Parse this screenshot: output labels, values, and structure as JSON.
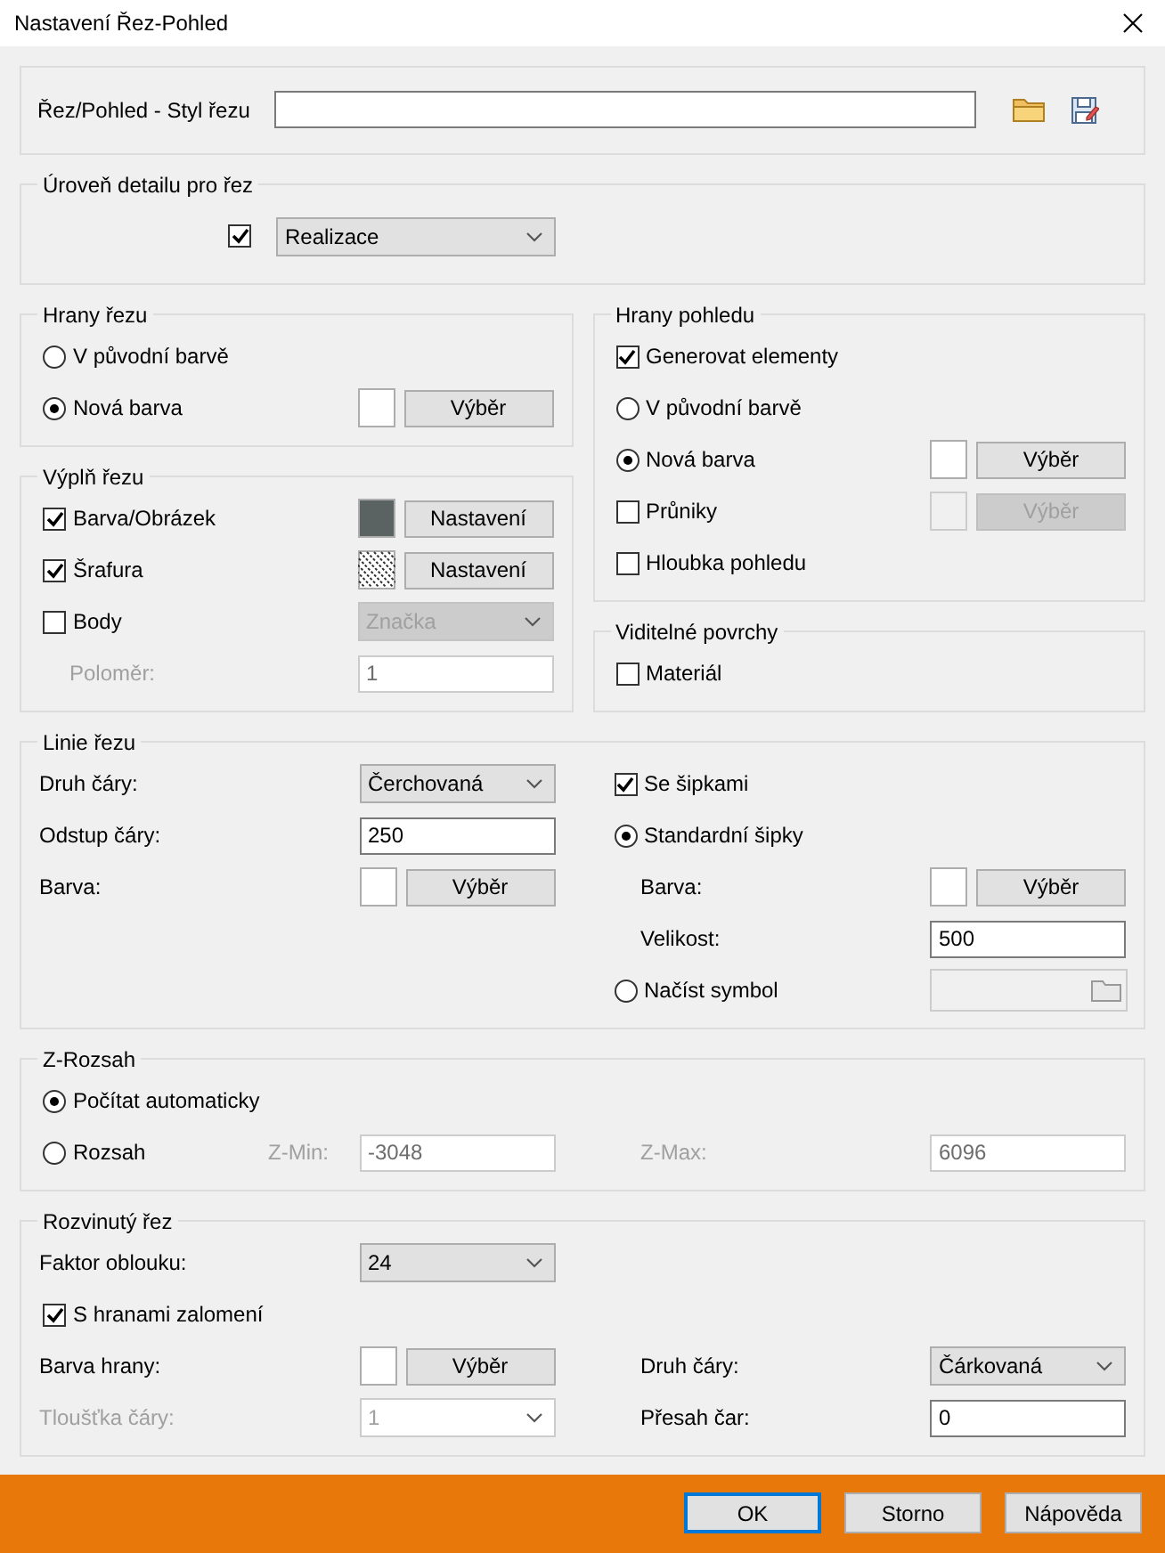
{
  "window": {
    "title": "Nastavení Řez-Pohled"
  },
  "style": {
    "label": "Řez/Pohled - Styl řezu"
  },
  "detail": {
    "legend": "Úroveň detailu pro řez",
    "checked": true,
    "value": "Realizace"
  },
  "columns": [
    [
      {
        "legend": "Hrany řezu",
        "rows": [
          {
            "kind": "radio",
            "label": "V původní barvě",
            "selected": false
          },
          {
            "kind": "radio",
            "label": "Nová barva",
            "selected": true,
            "control": {
              "kind": "color",
              "color": "#ffffff",
              "button": "Výběr",
              "disabled": false
            }
          }
        ]
      },
      {
        "legend": "Výplň řezu",
        "rows": [
          {
            "kind": "check",
            "label": "Barva/Obrázek",
            "checked": true,
            "control": {
              "kind": "color",
              "color": "#5a6361",
              "button": "Nastavení",
              "disabled": false
            }
          },
          {
            "kind": "check",
            "label": "Šrafura",
            "checked": true,
            "control": {
              "kind": "hatch",
              "button": "Nastavení",
              "disabled": false
            }
          },
          {
            "kind": "check",
            "label": "Body",
            "checked": false,
            "control": {
              "kind": "select",
              "value": "Značka",
              "disabled": true
            }
          },
          {
            "kind": "sublabel",
            "label": "Poloměr:",
            "disabled": true,
            "control": {
              "kind": "input",
              "value": "1",
              "disabled": true
            }
          }
        ]
      }
    ],
    [
      {
        "legend": "Hrany pohledu",
        "rows": [
          {
            "kind": "check",
            "label": "Generovat elementy",
            "checked": true
          },
          {
            "kind": "radio",
            "label": "V původní barvě",
            "selected": false
          },
          {
            "kind": "radio",
            "label": "Nová barva",
            "selected": true,
            "control": {
              "kind": "color",
              "color": "#ffffff",
              "button": "Výběr",
              "disabled": false
            }
          },
          {
            "kind": "check",
            "label": "Průniky",
            "checked": false,
            "control": {
              "kind": "color",
              "color": "#f0f0f0",
              "button": "Výběr",
              "disabled": true
            }
          },
          {
            "kind": "check",
            "label": "Hloubka pohledu",
            "checked": false
          }
        ]
      },
      {
        "legend": "Viditelné povrchy",
        "rows": [
          {
            "kind": "check",
            "label": "Materiál",
            "checked": false
          }
        ]
      }
    ]
  ],
  "wide_groups": [
    {
      "legend": "Linie řezu",
      "rows": [
        {
          "left": {
            "kind": "label",
            "label": "Druh čáry:",
            "disabled": false,
            "control": {
              "kind": "select",
              "value": "Čerchovaná",
              "disabled": false
            }
          },
          "right": {
            "kind": "check",
            "label": "Se šipkami",
            "checked": true
          }
        },
        {
          "left": {
            "kind": "label",
            "label": "Odstup čáry:",
            "disabled": false,
            "control": {
              "kind": "input",
              "value": "250",
              "disabled": false
            }
          },
          "right": {
            "kind": "radio",
            "label": "Standardní šipky",
            "selected": true
          }
        },
        {
          "left": {
            "kind": "label",
            "label": "Barva:",
            "disabled": false,
            "control": {
              "kind": "color",
              "color": "#ffffff",
              "button": "Výběr",
              "disabled": false
            }
          },
          "right": {
            "kind": "sublabel",
            "label": "Barva:",
            "disabled": false,
            "control": {
              "kind": "color",
              "color": "#ffffff",
              "button": "Výběr",
              "disabled": false
            }
          }
        },
        {
          "right": {
            "kind": "sublabel",
            "label": "Velikost:",
            "disabled": false,
            "control": {
              "kind": "input",
              "value": "500",
              "disabled": false
            }
          }
        },
        {
          "right": {
            "kind": "radio",
            "label": "Načíst symbol",
            "selected": false,
            "control": {
              "kind": "file",
              "disabled": true
            }
          }
        }
      ]
    },
    {
      "legend": "Z-Rozsah",
      "rows": [
        {
          "left": {
            "kind": "radio",
            "label": "Počítat automaticky",
            "selected": true
          }
        },
        {
          "left": {
            "kind": "radio",
            "label": "Rozsah",
            "selected": false,
            "field_label": "Z-Min:",
            "control": {
              "kind": "input",
              "value": "-3048",
              "disabled": true
            }
          },
          "right": {
            "kind": "sublabel",
            "label": "Z-Max:",
            "disabled": true,
            "control": {
              "kind": "input",
              "value": "6096",
              "disabled": true
            }
          }
        }
      ]
    },
    {
      "legend": "Rozvinutý řez",
      "rows": [
        {
          "left": {
            "kind": "label",
            "label": "Faktor oblouku:",
            "disabled": false,
            "control": {
              "kind": "select",
              "value": "24",
              "disabled": false
            }
          }
        },
        {
          "left": {
            "kind": "check",
            "label": "S hranami zalomení",
            "checked": true
          }
        },
        {
          "left": {
            "kind": "label",
            "label": "Barva hrany:",
            "disabled": false,
            "control": {
              "kind": "color",
              "color": "#ffffff",
              "button": "Výběr",
              "disabled": false
            }
          },
          "right": {
            "kind": "sublabel",
            "label": "Druh čáry:",
            "disabled": false,
            "control": {
              "kind": "select",
              "value": "Čárkovaná",
              "disabled": false
            }
          }
        },
        {
          "left": {
            "kind": "label",
            "label": "Tloušťka čáry:",
            "disabled": true,
            "control": {
              "kind": "combo",
              "value": "1",
              "disabled": true
            }
          },
          "right": {
            "kind": "sublabel",
            "label": "Přesah čar:",
            "disabled": false,
            "control": {
              "kind": "input",
              "value": "0",
              "disabled": false
            }
          }
        }
      ]
    }
  ],
  "buttons": [
    {
      "label": "OK",
      "default": true
    },
    {
      "label": "Storno",
      "default": false
    },
    {
      "label": "Nápověda",
      "default": false
    }
  ]
}
